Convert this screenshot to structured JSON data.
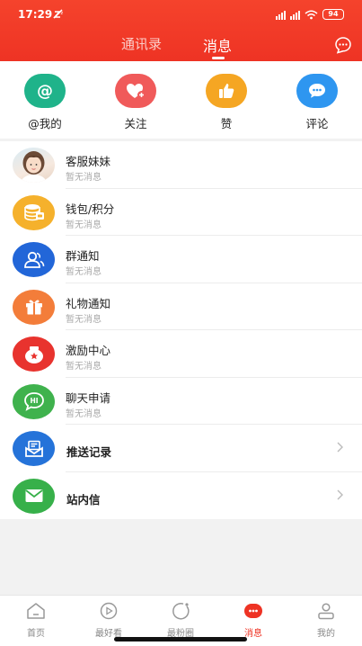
{
  "status": {
    "time": "17:29",
    "battery": "94"
  },
  "header": {
    "tabs": [
      {
        "label": "通讯录"
      },
      {
        "label": "消息"
      }
    ],
    "active_tab": "消息"
  },
  "quick_actions": [
    {
      "label": "@我的",
      "icon": "at-icon",
      "color": "#1fb38a"
    },
    {
      "label": "关注",
      "icon": "heart-plus-icon",
      "color": "#f05a5a"
    },
    {
      "label": "赞",
      "icon": "thumbs-up-icon",
      "color": "#f5a623"
    },
    {
      "label": "评论",
      "icon": "comment-icon",
      "color": "#2e96f0"
    }
  ],
  "messages": [
    {
      "title": "客服妹妹",
      "subtitle": "暂无消息",
      "icon": "customer-service-avatar"
    },
    {
      "title": "钱包/积分",
      "subtitle": "暂无消息",
      "icon": "wallet-coins-icon",
      "color": "#f5b12c"
    },
    {
      "title": "群通知",
      "subtitle": "暂无消息",
      "icon": "group-icon",
      "color": "#2266d8"
    },
    {
      "title": "礼物通知",
      "subtitle": "暂无消息",
      "icon": "gift-icon",
      "color": "#f37d3a"
    },
    {
      "title": "激励中心",
      "subtitle": "暂无消息",
      "icon": "reward-icon",
      "color": "#e8332e"
    },
    {
      "title": "聊天申请",
      "subtitle": "暂无消息",
      "icon": "chat-hi-icon",
      "color": "#3fb24d"
    }
  ],
  "links": [
    {
      "title": "推送记录",
      "icon": "push-record-icon",
      "color": "#2573d9"
    },
    {
      "title": "站内信",
      "icon": "mail-icon",
      "color": "#37b04a"
    }
  ],
  "bottom_nav": [
    {
      "label": "首页",
      "icon": "home-icon"
    },
    {
      "label": "最好看",
      "icon": "play-circle-icon"
    },
    {
      "label": "最粉圈",
      "icon": "circle-icon"
    },
    {
      "label": "消息",
      "icon": "message-icon",
      "active": true
    },
    {
      "label": "我的",
      "icon": "profile-icon"
    }
  ],
  "colors": {
    "accent": "#ee3324",
    "background": "#f2f2f2"
  }
}
